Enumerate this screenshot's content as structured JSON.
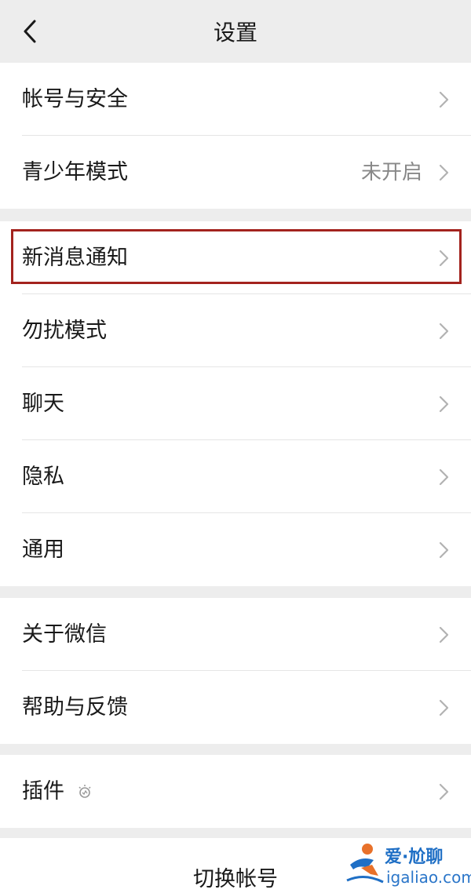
{
  "header": {
    "title": "设置",
    "back_icon": "chevron-left-icon"
  },
  "groups": [
    {
      "items": [
        {
          "label": "帐号与安全",
          "value": ""
        },
        {
          "label": "青少年模式",
          "value": "未开启"
        }
      ]
    },
    {
      "items": [
        {
          "label": "新消息通知",
          "value": "",
          "highlighted": true
        },
        {
          "label": "勿扰模式",
          "value": ""
        },
        {
          "label": "聊天",
          "value": ""
        },
        {
          "label": "隐私",
          "value": ""
        },
        {
          "label": "通用",
          "value": ""
        }
      ]
    },
    {
      "items": [
        {
          "label": "关于微信",
          "value": ""
        },
        {
          "label": "帮助与反馈",
          "value": ""
        }
      ]
    },
    {
      "items": [
        {
          "label": "插件",
          "value": "",
          "icon": "plugin-bulb-icon"
        }
      ]
    }
  ],
  "switch_account": {
    "label": "切换帐号"
  },
  "watermark": {
    "brand": "爱·尬聊",
    "url": "igaliao.com"
  },
  "colors": {
    "background": "#ededed",
    "surface": "#ffffff",
    "text": "#191919",
    "secondary_text": "#888888",
    "highlight_border": "#a3231e",
    "watermark_blue": "#1f6fc5"
  }
}
